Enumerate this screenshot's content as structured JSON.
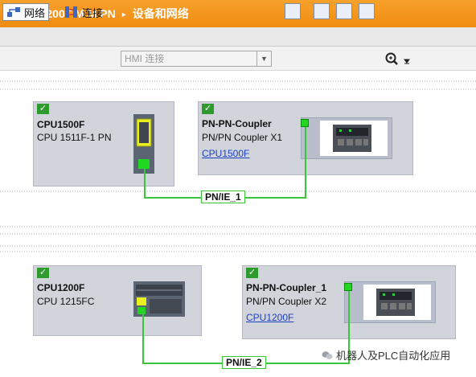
{
  "title": {
    "project": "1500F 1200F M M PN",
    "section": "设备和网络",
    "separator": "▸"
  },
  "toolbar": {
    "network_label": "网络",
    "connection_label": "连接",
    "connection_dropdown": "HMI 连接"
  },
  "devices": [
    {
      "name": "CPU1500F",
      "type": "CPU 1511F-1 PN",
      "status": "ok"
    },
    {
      "name": "PN-PN-Coupler",
      "type": "PN/PN Coupler X1",
      "link": "CPU1500F",
      "status": "ok"
    },
    {
      "name": "CPU1200F",
      "type": "CPU 1215FC",
      "status": "ok"
    },
    {
      "name": "PN-PN-Coupler_1",
      "type": "PN/PN Coupler X2",
      "link": "CPU1200F",
      "status": "ok"
    }
  ],
  "networks": [
    {
      "label": "PN/IE_1"
    },
    {
      "label": "PN/IE_2"
    }
  ],
  "watermark": "机器人及PLC自动化应用",
  "colors": {
    "title_bar": "#f39a1e",
    "network_wire": "#39c739",
    "device_fill": "#d2d4dc",
    "status_ok": "#2f9b2f",
    "link": "#1a3fc4"
  }
}
